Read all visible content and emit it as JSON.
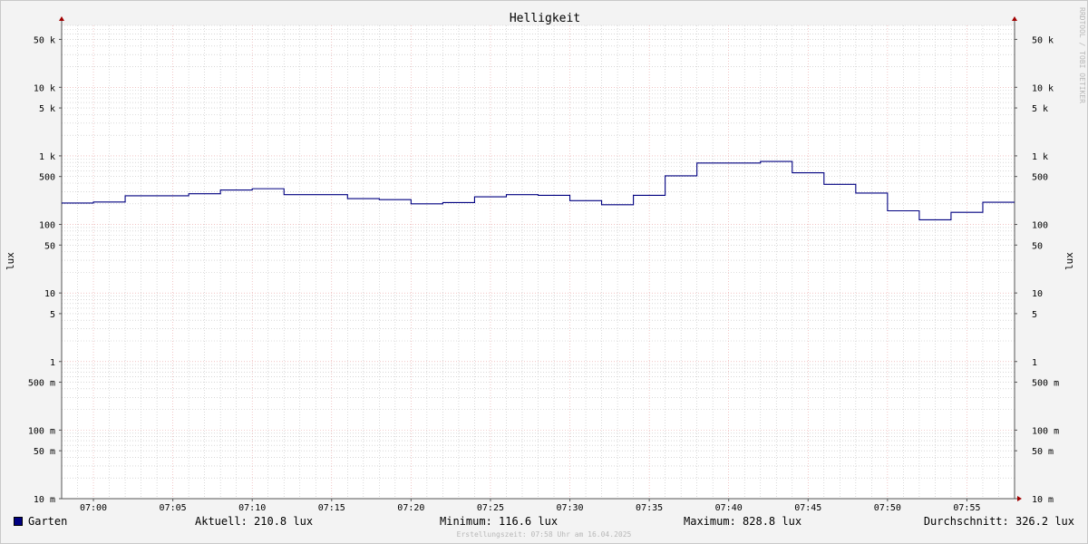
{
  "chart_data": {
    "type": "line",
    "title": "Helligkeit",
    "ylabel": "lux",
    "y_scale": "log",
    "ylim": [
      0.01,
      80000
    ],
    "y_ticks": [
      {
        "value": 50000,
        "label": "50 k"
      },
      {
        "value": 10000,
        "label": "10 k"
      },
      {
        "value": 5000,
        "label": "5 k"
      },
      {
        "value": 1000,
        "label": "1 k"
      },
      {
        "value": 500,
        "label": "500"
      },
      {
        "value": 100,
        "label": "100"
      },
      {
        "value": 50,
        "label": "50"
      },
      {
        "value": 10,
        "label": "10"
      },
      {
        "value": 5,
        "label": "5"
      },
      {
        "value": 1,
        "label": "1"
      },
      {
        "value": 0.5,
        "label": "500 m"
      },
      {
        "value": 0.1,
        "label": "100 m"
      },
      {
        "value": 0.05,
        "label": "50 m"
      },
      {
        "value": 0.01,
        "label": "10 m"
      }
    ],
    "x_unit": "time",
    "xlim": [
      "06:58",
      "07:58"
    ],
    "x_ticks": [
      "07:00",
      "07:05",
      "07:10",
      "07:15",
      "07:20",
      "07:25",
      "07:30",
      "07:35",
      "07:40",
      "07:45",
      "07:50",
      "07:55"
    ],
    "grid": true,
    "series": [
      {
        "name": "Garten",
        "color": "#000080",
        "step": true,
        "points": [
          {
            "x": "06:58",
            "y": 205
          },
          {
            "x": "07:00",
            "y": 212
          },
          {
            "x": "07:02",
            "y": 262
          },
          {
            "x": "07:06",
            "y": 280
          },
          {
            "x": "07:08",
            "y": 318
          },
          {
            "x": "07:10",
            "y": 332
          },
          {
            "x": "07:12",
            "y": 272
          },
          {
            "x": "07:16",
            "y": 238
          },
          {
            "x": "07:18",
            "y": 230
          },
          {
            "x": "07:20",
            "y": 200
          },
          {
            "x": "07:22",
            "y": 208
          },
          {
            "x": "07:24",
            "y": 253
          },
          {
            "x": "07:26",
            "y": 272
          },
          {
            "x": "07:28",
            "y": 266
          },
          {
            "x": "07:30",
            "y": 222
          },
          {
            "x": "07:32",
            "y": 194
          },
          {
            "x": "07:34",
            "y": 266
          },
          {
            "x": "07:36",
            "y": 512
          },
          {
            "x": "07:38",
            "y": 785
          },
          {
            "x": "07:42",
            "y": 828.8
          },
          {
            "x": "07:44",
            "y": 567
          },
          {
            "x": "07:46",
            "y": 384
          },
          {
            "x": "07:48",
            "y": 287
          },
          {
            "x": "07:50",
            "y": 158
          },
          {
            "x": "07:52",
            "y": 116.6
          },
          {
            "x": "07:54",
            "y": 150
          },
          {
            "x": "07:56",
            "y": 210.8
          },
          {
            "x": "07:58",
            "y": 210.8
          }
        ]
      }
    ]
  },
  "side_text": "RRDTOOL / TOBI OETIKER",
  "legend": {
    "series_name": "Garten",
    "series_color": "#000080",
    "current": "Aktuell: 210.8 lux",
    "minimum": "Minimum: 116.6 lux",
    "maximum": "Maximum: 828.8 lux",
    "average": "Durchschnitt: 326.2 lux"
  },
  "footer": "Erstellungszeit: 07:58 Uhr am 16.04.2025",
  "colors": {
    "background": "#f3f3f3",
    "plot_background": "#ffffff",
    "major_grid": "#e8a0a0",
    "minor_grid": "#c0c0c0",
    "axis_arrow": "#a00000"
  }
}
